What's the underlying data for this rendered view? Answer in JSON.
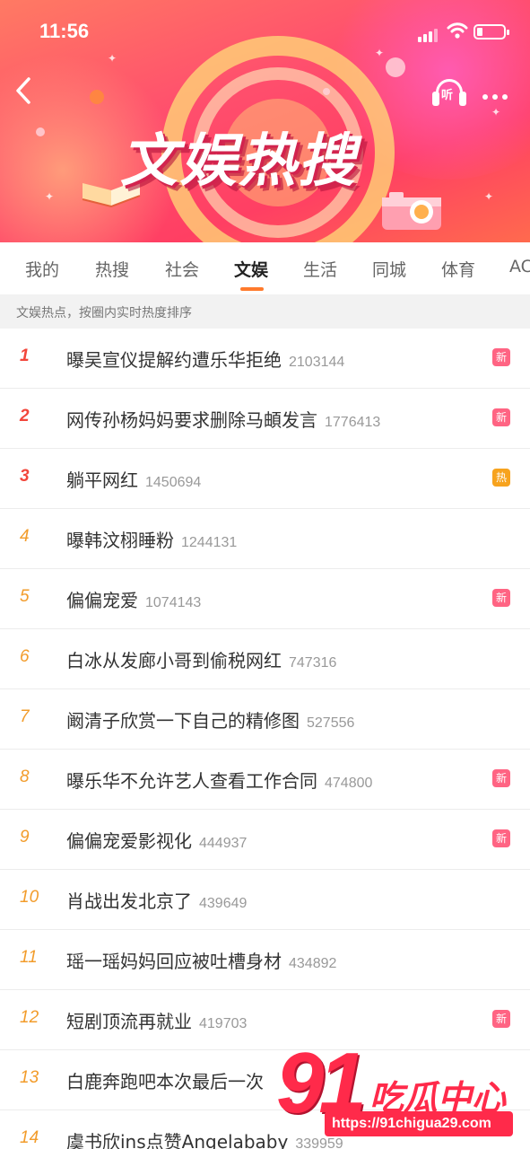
{
  "status_bar": {
    "time": "11:56"
  },
  "banner": {
    "title": "文娱热搜",
    "listen_label": "听"
  },
  "tabs": [
    {
      "label": "我的"
    },
    {
      "label": "热搜"
    },
    {
      "label": "社会"
    },
    {
      "label": "文娱",
      "active": true
    },
    {
      "label": "生活"
    },
    {
      "label": "同城"
    },
    {
      "label": "体育"
    },
    {
      "label": "AC"
    }
  ],
  "subheader": "文娱热点，按圈内实时热度排序",
  "items": [
    {
      "rank": "1",
      "title": "曝吴宣仪提解约遭乐华拒绝",
      "count": "2103144",
      "badge": "新"
    },
    {
      "rank": "2",
      "title": "网传孙杨妈妈要求删除马頔发言",
      "count": "1776413",
      "badge": "新"
    },
    {
      "rank": "3",
      "title": "躺平网红",
      "count": "1450694",
      "badge": "热"
    },
    {
      "rank": "4",
      "title": "曝韩汶栩睡粉",
      "count": "1244131",
      "badge": ""
    },
    {
      "rank": "5",
      "title": "偏偏宠爱",
      "count": "1074143",
      "badge": "新"
    },
    {
      "rank": "6",
      "title": "白冰从发廊小哥到偷税网红",
      "count": "747316",
      "badge": ""
    },
    {
      "rank": "7",
      "title": "阚清子欣赏一下自己的精修图",
      "count": "527556",
      "badge": ""
    },
    {
      "rank": "8",
      "title": "曝乐华不允许艺人查看工作合同",
      "count": "474800",
      "badge": "新"
    },
    {
      "rank": "9",
      "title": "偏偏宠爱影视化",
      "count": "444937",
      "badge": "新"
    },
    {
      "rank": "10",
      "title": "肖战出发北京了",
      "count": "439649",
      "badge": ""
    },
    {
      "rank": "11",
      "title": "瑶一瑶妈妈回应被吐槽身材",
      "count": "434892",
      "badge": ""
    },
    {
      "rank": "12",
      "title": "短剧顶流再就业",
      "count": "419703",
      "badge": "新"
    },
    {
      "rank": "13",
      "title": "白鹿奔跑吧本次最后一次",
      "count": "",
      "badge": ""
    },
    {
      "rank": "14",
      "title": "虞书欣ins点赞Angelababy",
      "count": "339959",
      "badge": ""
    }
  ],
  "watermark": {
    "number": "91",
    "name": "吃瓜中心",
    "url": "https://91chigua29.com"
  },
  "colors": {
    "rank_top": "#f2463b",
    "rank_rest": "#f29c2b",
    "badge_new": "#ff4a6e",
    "badge_hot": "#f7a31e",
    "tab_indicator": "#ff7a2c"
  }
}
